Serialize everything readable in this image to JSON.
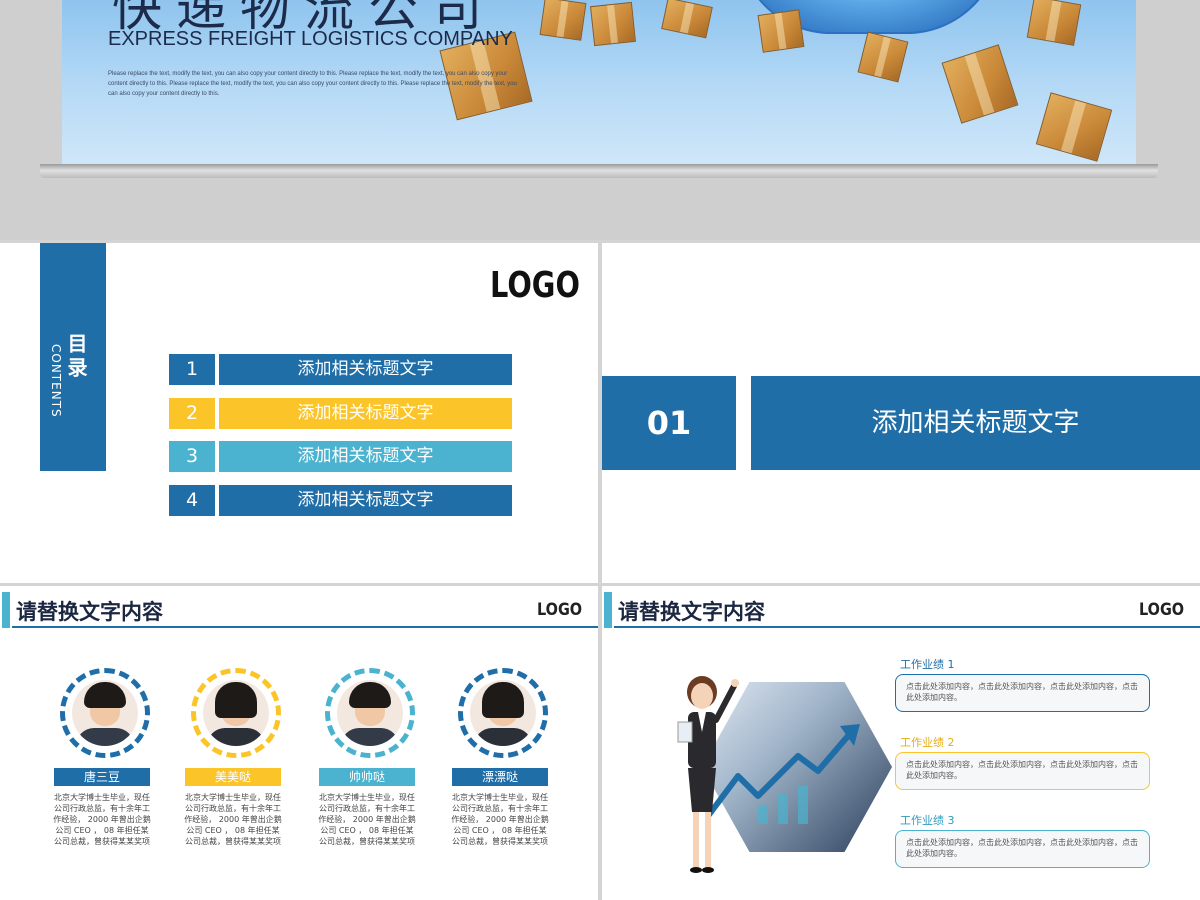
{
  "banner": {
    "title_cn": "快递物流公司",
    "subtitle_en": "EXPRESS FREIGHT LOGISTICS COMPANY",
    "description": "Please replace the text, modify the text, you can also copy your content directly to this. Please replace the text, modify the text, you can also copy your content directly to this. Please replace the text, modify the text, you can also copy your content directly to this. Please replace the text, modify the text, you can also copy your content directly to this."
  },
  "contents": {
    "title_cn": "目录",
    "title_en": "CONTENTS",
    "logo": "LOGO",
    "items": [
      {
        "num": "1",
        "label": "添加相关标题文字",
        "color": "#1f6ea8"
      },
      {
        "num": "2",
        "label": "添加相关标题文字",
        "color": "#fbc52a"
      },
      {
        "num": "3",
        "label": "添加相关标题文字",
        "color": "#4bb3cf"
      },
      {
        "num": "4",
        "label": "添加相关标题文字",
        "color": "#1f6ea8"
      }
    ]
  },
  "section": {
    "number": "01",
    "title": "添加相关标题文字"
  },
  "team": {
    "header": "请替换文字内容",
    "logo": "LOGO",
    "members": [
      {
        "name": "唐三豆",
        "color": "#1f6ea8",
        "desc": "北京大学博士生毕业，现任公司行政总监，有十余年工作经验， 2000 年曾出企鹅公司 CEO ， 08 年担任某公司总裁，曾获得某某奖项"
      },
      {
        "name": "美美哒",
        "color": "#fbc52a",
        "desc": "北京大学博士生毕业，现任公司行政总监，有十余年工作经验， 2000 年曾出企鹅公司 CEO ， 08 年担任某公司总裁，曾获得某某奖项"
      },
      {
        "name": "帅帅哒",
        "color": "#4bb3cf",
        "desc": "北京大学博士生毕业，现任公司行政总监，有十余年工作经验， 2000 年曾出企鹅公司 CEO ， 08 年担任某公司总裁，曾获得某某奖项"
      },
      {
        "name": "漂漂哒",
        "color": "#1f6ea8",
        "desc": "北京大学博士生毕业，现任公司行政总监，有十余年工作经验， 2000 年曾出企鹅公司 CEO ， 08 年担任某公司总裁，曾获得某某奖项"
      }
    ]
  },
  "performance": {
    "header": "请替换文字内容",
    "logo": "LOGO",
    "items": [
      {
        "label": "工作业绩 1",
        "color": "#1f6ea8",
        "text": "点击此处添加内容，点击此处添加内容，点击此处添加内容，点击此处添加内容。"
      },
      {
        "label": "工作业绩 2",
        "color": "#fbc52a",
        "text": "点击此处添加内容，点击此处添加内容，点击此处添加内容，点击此处添加内容。"
      },
      {
        "label": "工作业绩 3",
        "color": "#4bb3cf",
        "text": "点击此处添加内容，点击此处添加内容，点击此处添加内容，点击此处添加内容。"
      }
    ]
  }
}
